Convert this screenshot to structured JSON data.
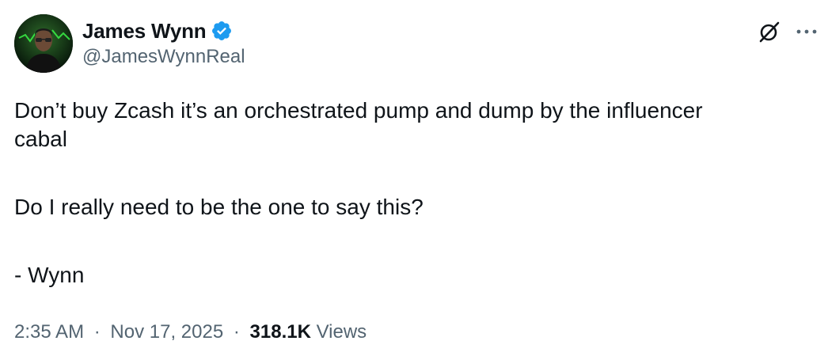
{
  "author": {
    "display_name": "James Wynn",
    "handle": "@JamesWynnReal",
    "verified": true,
    "verified_color": "#1d9bf0"
  },
  "icons": {
    "grok": "grok-icon",
    "more": "more-options-icon",
    "verified": "verified-badge-icon"
  },
  "tweet": {
    "line1": "Don’t buy Zcash it’s an orchestrated pump and dump by the influencer",
    "line2": "cabal",
    "line3": "Do I really need to be the one to say this?",
    "line4": "- Wynn"
  },
  "meta": {
    "time": "2:35 AM",
    "separator": "·",
    "date": "Nov 17, 2025",
    "views_count": "318.1K",
    "views_label": "Views"
  },
  "colors": {
    "text_primary": "#0f1419",
    "text_secondary": "#536471",
    "background": "#ffffff"
  }
}
